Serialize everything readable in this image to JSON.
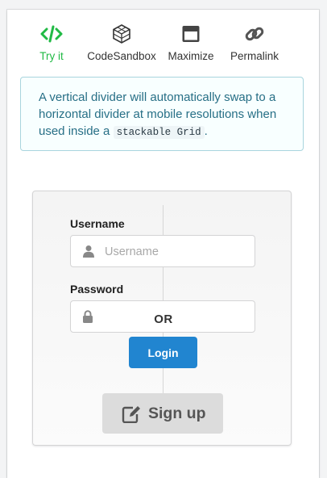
{
  "toolbar": {
    "items": [
      {
        "label": "Try it",
        "icon": "code-icon",
        "active": true
      },
      {
        "label": "CodeSandbox",
        "icon": "codesandbox-icon"
      },
      {
        "label": "Maximize",
        "icon": "window-maximize-icon"
      },
      {
        "label": "Permalink",
        "icon": "link-icon"
      }
    ]
  },
  "message": {
    "text_before": "A vertical divider will automatically swap to a horizontal divider at mobile resolutions when used inside a ",
    "code": "stackable Grid",
    "text_after": "."
  },
  "form": {
    "username_label": "Username",
    "username_placeholder": "Username",
    "username_value": "",
    "password_label": "Password",
    "password_value": "",
    "login_label": "Login"
  },
  "divider": {
    "label": "OR"
  },
  "signup": {
    "label": "Sign up",
    "icon": "edit-icon"
  },
  "colors": {
    "accent_green": "#21ba45",
    "primary_blue": "#2185d0",
    "info_text": "#276f86",
    "info_bg": "#f8ffff"
  }
}
